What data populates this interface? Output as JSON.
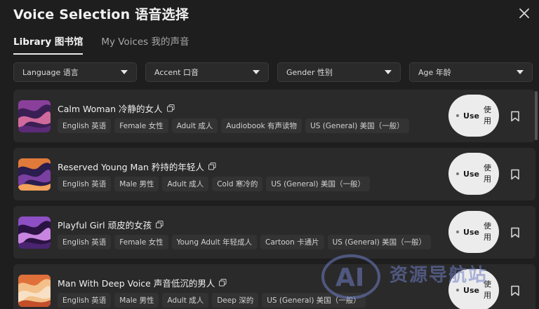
{
  "dialog": {
    "title": "Voice Selection 语音选择"
  },
  "tabs": [
    {
      "label": "Library 图书馆",
      "active": true
    },
    {
      "label": "My Voices 我的声音",
      "active": false
    }
  ],
  "filters": [
    {
      "label": "Language 语言"
    },
    {
      "label": "Accent 口音"
    },
    {
      "label": "Gender 性别"
    },
    {
      "label": "Age 年龄"
    }
  ],
  "use_button": {
    "main": "Use",
    "cn_line1": "使",
    "cn_line2": "用"
  },
  "voices": [
    {
      "name": "Calm Woman 冷静的女人",
      "tags": [
        "English 英语",
        "Female 女性",
        "Adult 成人",
        "Audiobook 有声读物",
        "US (General) 美国（一般）"
      ],
      "colors": [
        "#3a1f55",
        "#8a3f9a",
        "#d06a9c",
        "#5c2b78"
      ]
    },
    {
      "name": "Reserved Young Man 矜持的年轻人",
      "tags": [
        "English 英语",
        "Male 男性",
        "Adult 成人",
        "Cold 寒冷的",
        "US (General) 美国（一般）"
      ],
      "colors": [
        "#2b1d4d",
        "#e07a3a",
        "#7a3fa0",
        "#f2a25a"
      ]
    },
    {
      "name": "Playful Girl 顽皮的女孩",
      "tags": [
        "English 英语",
        "Female 女性",
        "Young Adult 年轻成人",
        "Cartoon 卡通片",
        "US (General) 美国（一般）"
      ],
      "colors": [
        "#2a1342",
        "#8e4fc4",
        "#c785e0",
        "#4a2470"
      ]
    },
    {
      "name": "Man With Deep Voice 声音低沉的男人",
      "tags": [
        "English 英语",
        "Male 男性",
        "Adult 成人",
        "Deep 深的",
        "US (General) 美国（一般）"
      ],
      "colors": [
        "#f3c08a",
        "#e0703a",
        "#f7e0c4",
        "#c24f2a"
      ]
    }
  ],
  "watermark": {
    "text": "资源导航站",
    "logo_text": "AI"
  }
}
